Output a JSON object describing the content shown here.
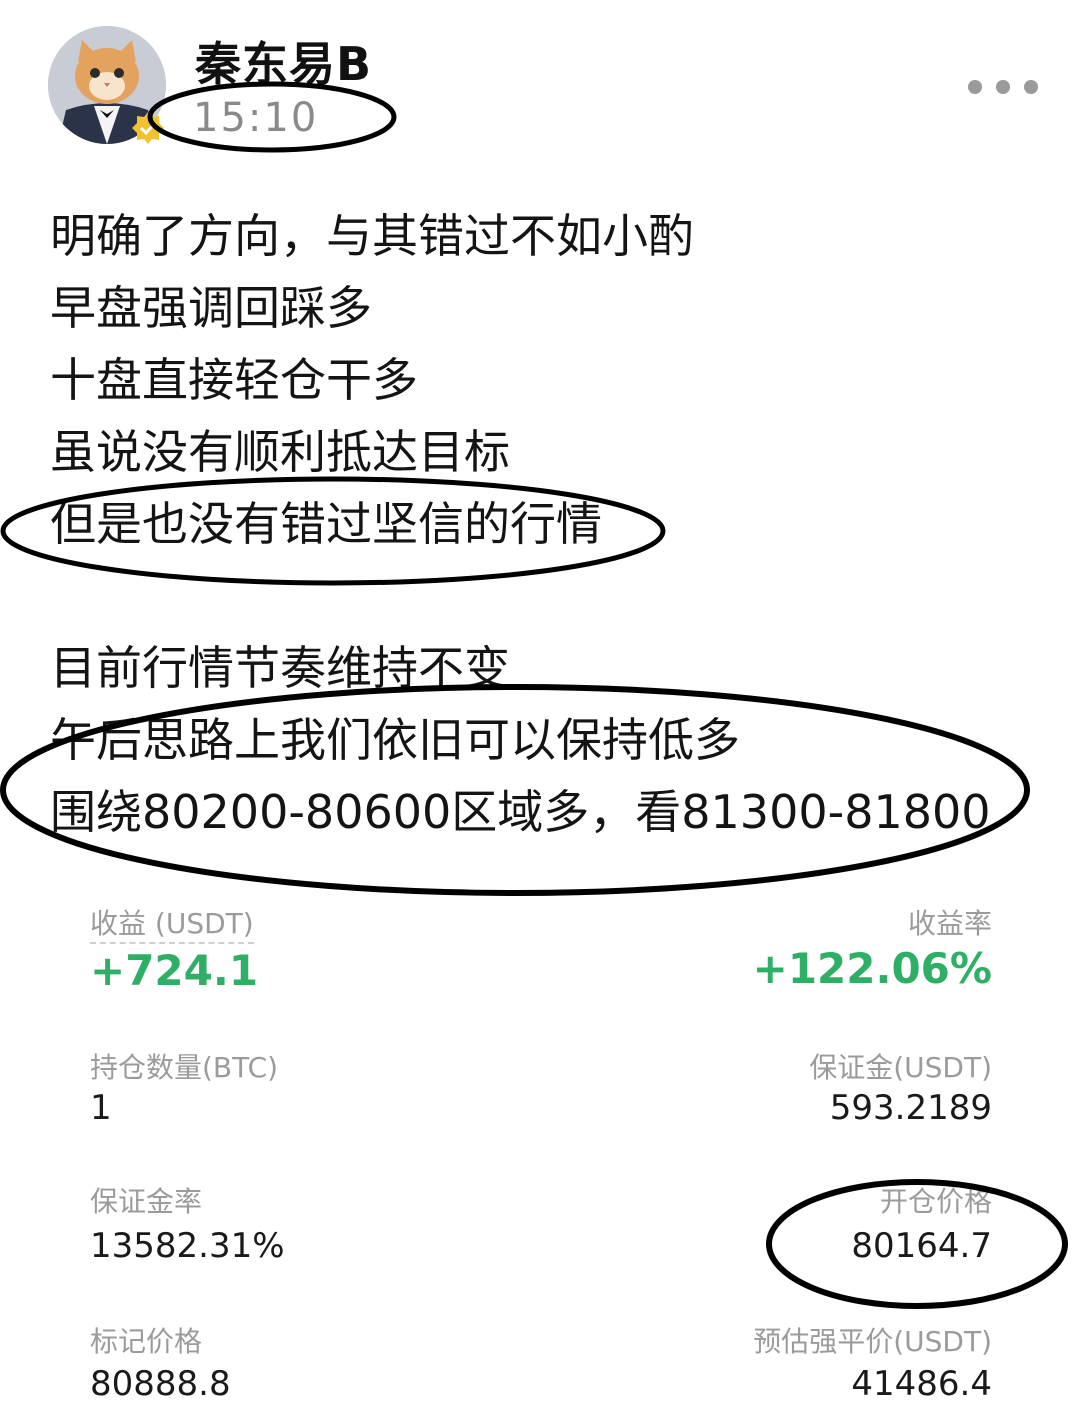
{
  "post": {
    "author": "秦东易B",
    "time": "15:10",
    "lines": [
      "明确了方向，与其错过不如小酌",
      "早盘强调回踩多",
      "十盘直接轻仓干多",
      "虽说没有顺利抵达目标",
      "但是也没有错过坚信的行情",
      "目前行情节奏维持不变",
      "午后思路上我们依旧可以保持低多",
      "围绕80200-80600区域多，看81300-81800"
    ]
  },
  "position": {
    "pnl_label": "收益 (USDT)",
    "pnl_value": "+724.1",
    "roi_label": "收益率",
    "roi_value": "+122.06%",
    "size_label": "持仓数量(BTC)",
    "size_value": "1",
    "margin_label": "保证金(USDT)",
    "margin_value": "593.2189",
    "margin_ratio_label": "保证金率",
    "margin_ratio_value": "13582.31%",
    "entry_price_label": "开仓价格",
    "entry_price_value": "80164.7",
    "mark_price_label": "标记价格",
    "mark_price_value": "80888.8",
    "liq_price_label": "预估强平价(USDT)",
    "liq_price_value": "41486.4"
  },
  "colors": {
    "profit": "#2fae65",
    "muted": "#9b9b9b",
    "text": "#141414",
    "annotation": "#000000"
  },
  "icons": {
    "avatar": "cat-in-tuxedo-avatar",
    "badge": "verified-badge-icon",
    "more": "more-options-icon"
  }
}
